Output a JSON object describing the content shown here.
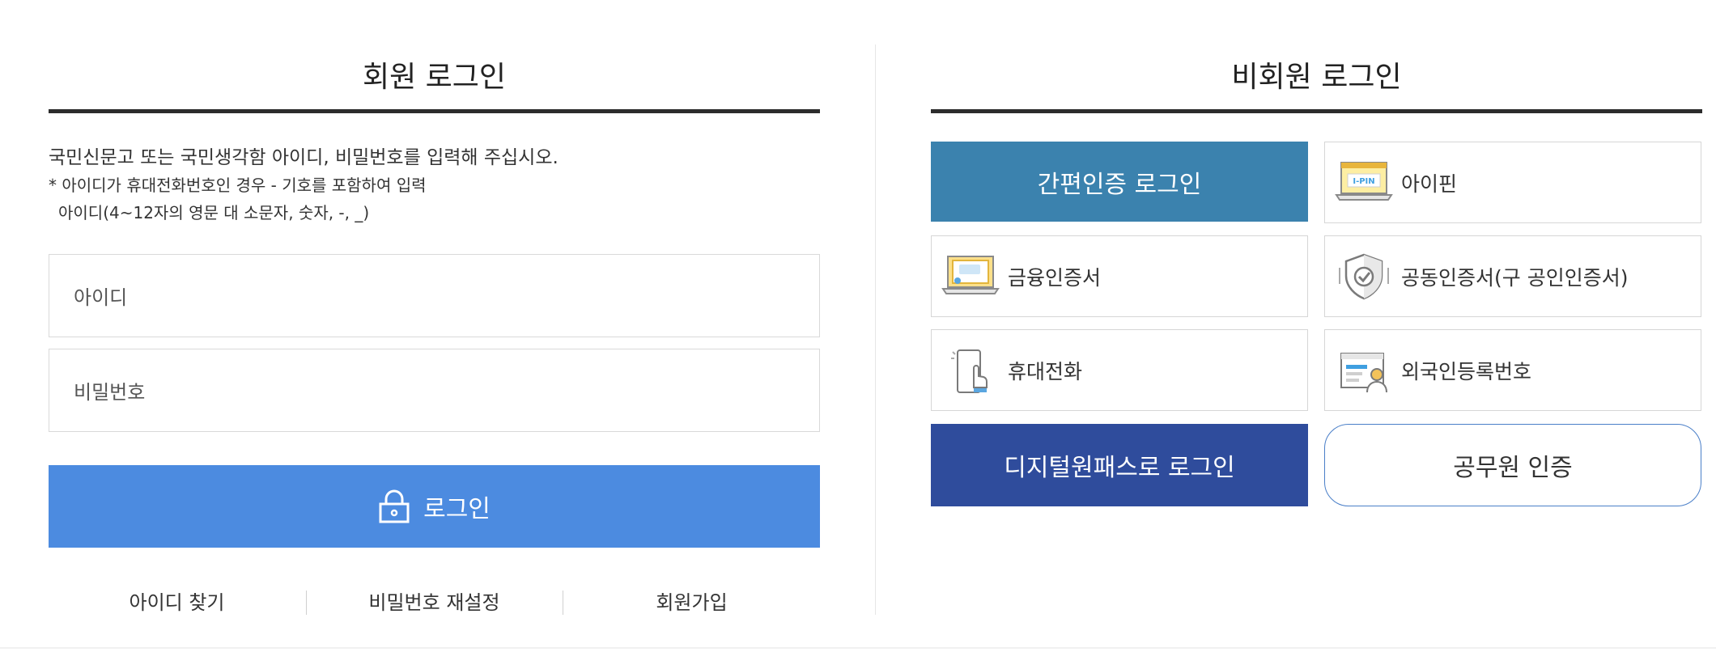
{
  "member": {
    "title": "회원 로그인",
    "guide_main": "국민신문고 또는 국민생각함 아이디, 비밀번호를 입력해 주십시오.",
    "guide_note1": "* 아이디가 휴대전화번호인 경우 - 기호를 포함하여 입력",
    "guide_note2": "아이디(4~12자의 영문 대 소문자, 숫자, -, _)",
    "id_placeholder": "아이디",
    "pw_placeholder": "비밀번호",
    "login_label": "로그인",
    "links": {
      "find_id": "아이디 찾기",
      "reset_pw": "비밀번호 재설정",
      "signup": "회원가입"
    }
  },
  "nonmember": {
    "title": "비회원 로그인",
    "simple_auth": "간편인증 로그인",
    "ipin": "아이핀",
    "ipin_badge": "I-PIN",
    "financial_cert": "금융인증서",
    "joint_cert": "공동인증서(구 공인인증서)",
    "mobile": "휴대전화",
    "foreigner": "외국인등록번호",
    "digital_onepass": "디지털원패스로 로그인",
    "official_auth": "공무원 인증"
  },
  "icons": {
    "lock": "lock-icon",
    "ipin": "ipin-laptop-icon",
    "financial": "financial-cert-laptop-icon",
    "shield": "shield-check-icon",
    "mobile": "phone-touch-icon",
    "foreigner": "id-card-person-icon"
  },
  "colors": {
    "login_button": "#4c8be0",
    "simple_auth": "#3b82ae",
    "digital_onepass": "#2f4c9c",
    "official_border": "#4a7fc8",
    "title_rule": "#2c2c2c"
  }
}
